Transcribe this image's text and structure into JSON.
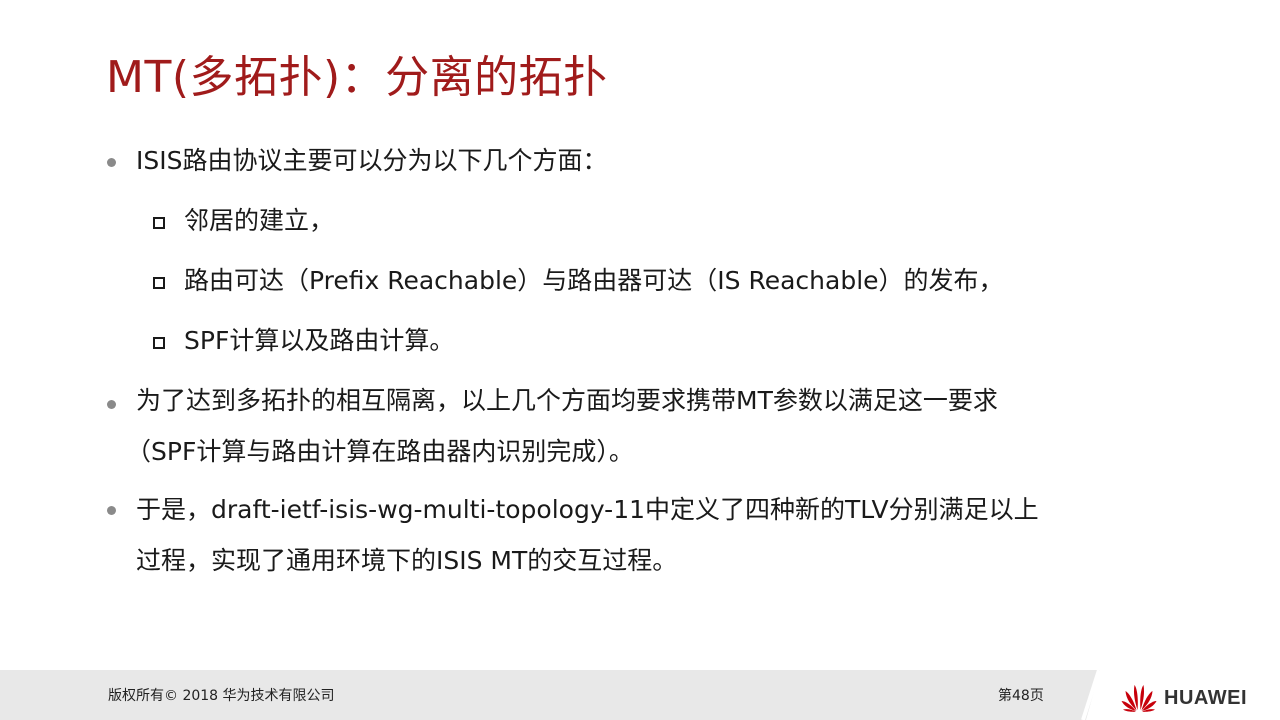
{
  "slide": {
    "title": "MT(多拓扑)：分离的拓扑"
  },
  "bullets": [
    {
      "lines": [
        "ISIS路由协议主要可以分为以下几个方面："
      ],
      "sub_items": [
        "邻居的建立，",
        "路由可达（Prefix Reachable）与路由器可达（IS Reachable）的发布，",
        "SPF计算以及路由计算。"
      ]
    },
    {
      "lines": [
        "为了达到多拓扑的相互隔离，以上几个方面均要求携带MT参数以满足这一要求",
        "（SPF计算与路由计算在路由器内识别完成）。"
      ]
    },
    {
      "lines": [
        "于是，draft-ietf-isis-wg-multi-topology-11中定义了四种新的TLV分别满足以上",
        "过程，实现了通用环境下的ISIS MT的交互过程。"
      ]
    }
  ],
  "footer": {
    "copyright": "版权所有© 2018 华为技术有限公司",
    "page": "第48页",
    "brand": "HUAWEI"
  },
  "colors": {
    "title": "#a01b1b",
    "logo_red": "#c7000b",
    "footer_bg": "#e8e8e8"
  }
}
